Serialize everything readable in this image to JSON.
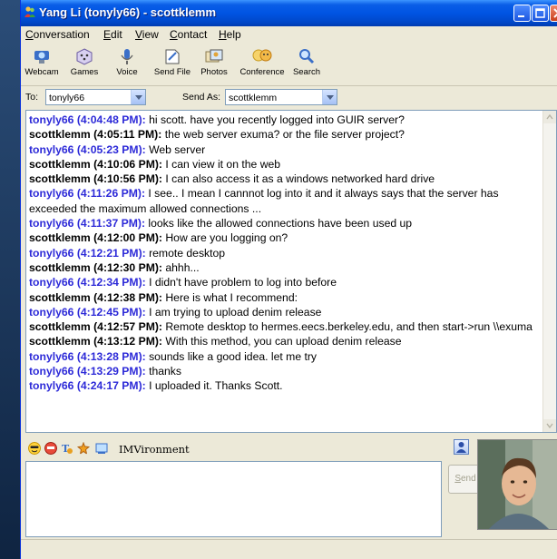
{
  "window": {
    "title": "Yang Li (tonyly66) - scottklemm"
  },
  "menu": [
    "Conversation",
    "Edit",
    "View",
    "Contact",
    "Help"
  ],
  "toolbar": [
    {
      "label": "Webcam",
      "icon": "webcam-icon"
    },
    {
      "label": "Games",
      "icon": "games-icon"
    },
    {
      "label": "Voice",
      "icon": "voice-icon"
    },
    {
      "label": "Send File",
      "icon": "send-file-icon"
    },
    {
      "label": "Photos",
      "icon": "photos-icon"
    },
    {
      "label": "Conference",
      "icon": "conference-icon"
    },
    {
      "label": "Search",
      "icon": "search-icon"
    }
  ],
  "to": {
    "label": "To:",
    "value": "tonyly66"
  },
  "send_as": {
    "label": "Send As:",
    "value": "scottklemm"
  },
  "messages": [
    {
      "who": "tonyly66 (4:04:48 PM):",
      "text": " hi scott. have you recently logged into GUIR server?",
      "side": "t"
    },
    {
      "who": "scottklemm (4:05:11 PM):",
      "text": " the web server exuma? or the file server project?",
      "side": "s"
    },
    {
      "who": "tonyly66 (4:05:23 PM):",
      "text": " Web server",
      "side": "t"
    },
    {
      "who": "scottklemm (4:10:06 PM):",
      "text": " I can view it on the web",
      "side": "s"
    },
    {
      "who": "scottklemm (4:10:56 PM):",
      "text": " I can also access it as a windows networked hard drive",
      "side": "s"
    },
    {
      "who": "tonyly66 (4:11:26 PM):",
      "text": " I see.. I mean I cannnot log into it and it always says that the server has exceeded the maximum allowed connections ...",
      "side": "t"
    },
    {
      "who": "tonyly66 (4:11:37 PM):",
      "text": " looks like the allowed connections have been used up",
      "side": "t"
    },
    {
      "who": "scottklemm (4:12:00 PM):",
      "text": " How are you logging on?",
      "side": "s"
    },
    {
      "who": "tonyly66 (4:12:21 PM):",
      "text": " remote desktop",
      "side": "t"
    },
    {
      "who": "scottklemm (4:12:30 PM):",
      "text": " ahhh...",
      "side": "s"
    },
    {
      "who": "tonyly66 (4:12:34 PM):",
      "text": " I didn't have problem to log into before",
      "side": "t"
    },
    {
      "who": "scottklemm (4:12:38 PM):",
      "text": " Here is what I recommend:",
      "side": "s"
    },
    {
      "who": "tonyly66 (4:12:45 PM):",
      "text": " I am trying to upload denim release",
      "side": "t"
    },
    {
      "who": "scottklemm (4:12:57 PM):",
      "text": " Remote desktop to hermes.eecs.berkeley.edu, and then start->run \\\\exuma",
      "side": "s"
    },
    {
      "who": "scottklemm (4:13:12 PM):",
      "text": " With this method, you can upload denim release",
      "side": "s"
    },
    {
      "who": "tonyly66 (4:13:28 PM):",
      "text": " sounds like a good idea. let me try",
      "side": "t"
    },
    {
      "who": "tonyly66 (4:13:29 PM):",
      "text": " thanks",
      "side": "t"
    },
    {
      "who": "tonyly66 (4:24:17 PM):",
      "text": " I uploaded it. Thanks Scott.",
      "side": "t"
    }
  ],
  "imvironment": "IMVironment",
  "send_label": "Send",
  "colors": {
    "other_user": "#2d2ad8",
    "self_user": "#000000",
    "titlebar": "#0054e3"
  }
}
